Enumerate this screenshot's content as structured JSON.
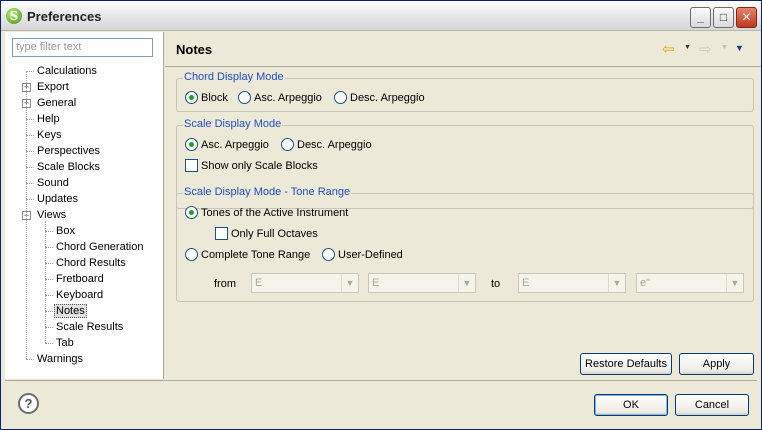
{
  "window": {
    "title": "Preferences"
  },
  "filter": {
    "placeholder": "type filter text"
  },
  "tree": [
    {
      "label": "Calculations",
      "depth": 0,
      "expandable": false
    },
    {
      "label": "Export",
      "depth": 0,
      "expandable": true,
      "expanded": false
    },
    {
      "label": "General",
      "depth": 0,
      "expandable": true,
      "expanded": false
    },
    {
      "label": "Help",
      "depth": 0,
      "expandable": false
    },
    {
      "label": "Keys",
      "depth": 0,
      "expandable": false
    },
    {
      "label": "Perspectives",
      "depth": 0,
      "expandable": false
    },
    {
      "label": "Scale Blocks",
      "depth": 0,
      "expandable": false
    },
    {
      "label": "Sound",
      "depth": 0,
      "expandable": false
    },
    {
      "label": "Updates",
      "depth": 0,
      "expandable": false
    },
    {
      "label": "Views",
      "depth": 0,
      "expandable": true,
      "expanded": true
    },
    {
      "label": "Box",
      "depth": 1,
      "expandable": false
    },
    {
      "label": "Chord Generation",
      "depth": 1,
      "expandable": false
    },
    {
      "label": "Chord Results",
      "depth": 1,
      "expandable": false
    },
    {
      "label": "Fretboard",
      "depth": 1,
      "expandable": false
    },
    {
      "label": "Keyboard",
      "depth": 1,
      "expandable": false
    },
    {
      "label": "Notes",
      "depth": 1,
      "expandable": false,
      "selected": true
    },
    {
      "label": "Scale Results",
      "depth": 1,
      "expandable": false
    },
    {
      "label": "Tab",
      "depth": 1,
      "expandable": false
    },
    {
      "label": "Warnings",
      "depth": 0,
      "expandable": false
    }
  ],
  "page": {
    "title": "Notes",
    "chord_display": {
      "title": "Chord Display Mode",
      "options": [
        {
          "label": "Block",
          "selected": true
        },
        {
          "label": "Asc. Arpeggio",
          "selected": false
        },
        {
          "label": "Desc. Arpeggio",
          "selected": false
        }
      ]
    },
    "scale_display": {
      "title": "Scale Display Mode",
      "options": [
        {
          "label": "Asc. Arpeggio",
          "selected": true
        },
        {
          "label": "Desc. Arpeggio",
          "selected": false
        }
      ],
      "show_only_blocks": {
        "label": "Show only Scale Blocks",
        "checked": false
      }
    },
    "tone_range": {
      "title": "Scale Display Mode - Tone Range",
      "active_instrument": {
        "label": "Tones of the Active Instrument",
        "selected": true
      },
      "only_full_octaves": {
        "label": "Only Full Octaves",
        "checked": false
      },
      "complete": {
        "label": "Complete Tone Range",
        "selected": false
      },
      "user_defined": {
        "label": "User-Defined",
        "selected": false
      },
      "from_label": "from",
      "to_label": "to",
      "combos": [
        "E",
        "E",
        "E",
        "e\""
      ]
    },
    "restore_defaults": "Restore Defaults",
    "apply": "Apply"
  },
  "footer": {
    "ok": "OK",
    "cancel": "Cancel"
  },
  "icons": {
    "app": "app-icon",
    "minimize": "minimize-icon",
    "maximize": "maximize-icon",
    "close": "close-icon",
    "back": "back-arrow-icon",
    "forward": "forward-arrow-icon",
    "menu": "view-menu-icon",
    "help": "help-icon"
  }
}
